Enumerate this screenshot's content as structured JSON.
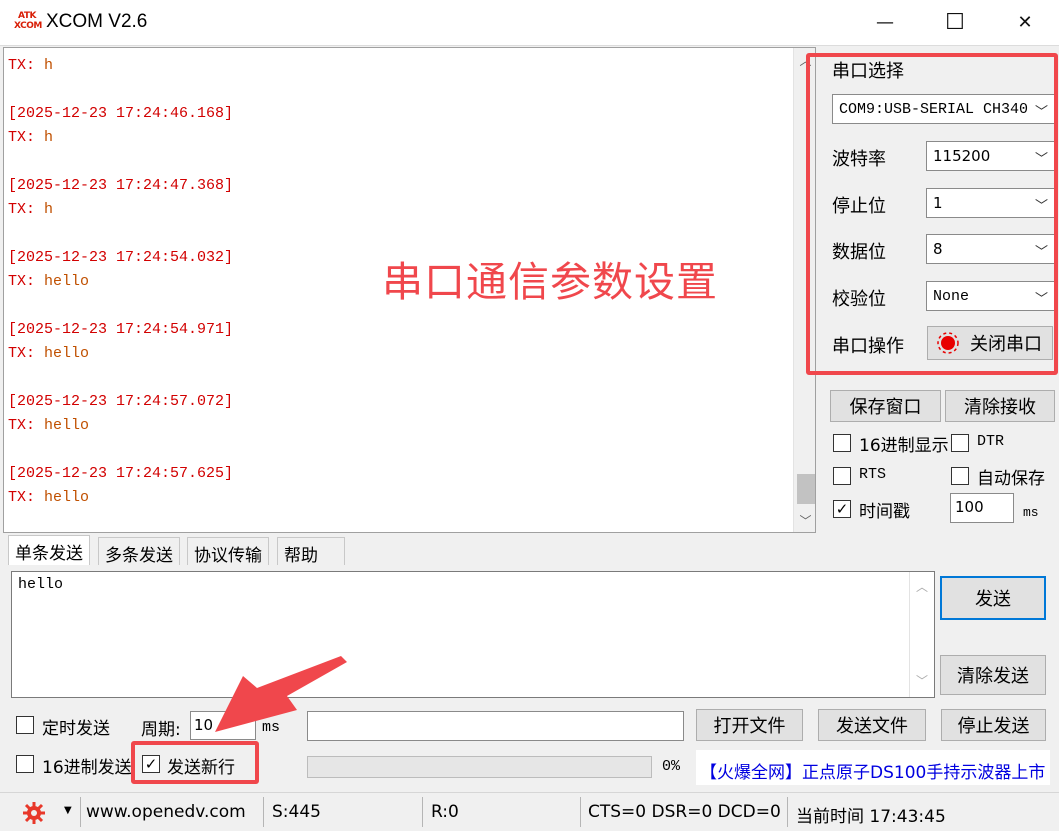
{
  "window": {
    "title": "XCOM V2.6",
    "icon_text_top": "ATK",
    "icon_text_bottom": "XCOM",
    "minimize": "—",
    "maximize": "☐",
    "close": "✕"
  },
  "receive": {
    "lines": [
      {
        "kind": "tx",
        "label": "TX:",
        "data": "h"
      },
      {
        "kind": "blank"
      },
      {
        "kind": "ts",
        "text": "[2025-12-23 17:24:46.168]"
      },
      {
        "kind": "tx",
        "label": "TX:",
        "data": "h"
      },
      {
        "kind": "blank"
      },
      {
        "kind": "ts",
        "text": "[2025-12-23 17:24:47.368]"
      },
      {
        "kind": "tx",
        "label": "TX:",
        "data": "h"
      },
      {
        "kind": "blank"
      },
      {
        "kind": "ts",
        "text": "[2025-12-23 17:24:54.032]"
      },
      {
        "kind": "tx",
        "label": "TX:",
        "data": "hello"
      },
      {
        "kind": "blank"
      },
      {
        "kind": "ts",
        "text": "[2025-12-23 17:24:54.971]"
      },
      {
        "kind": "tx",
        "label": "TX:",
        "data": "hello"
      },
      {
        "kind": "blank"
      },
      {
        "kind": "ts",
        "text": "[2025-12-23 17:24:57.072]"
      },
      {
        "kind": "tx",
        "label": "TX:",
        "data": "hello"
      },
      {
        "kind": "blank"
      },
      {
        "kind": "ts",
        "text": "[2025-12-23 17:24:57.625]"
      },
      {
        "kind": "tx",
        "label": "TX:",
        "data": "hello"
      }
    ],
    "annotation": "串口通信参数设置"
  },
  "serial": {
    "section_label": "串口选择",
    "port_value": "COM9:USB-SERIAL CH340",
    "baud_label": "波特率",
    "baud_value": "115200",
    "stop_label": "停止位",
    "stop_value": "1",
    "data_label": "数据位",
    "data_value": "8",
    "parity_label": "校验位",
    "parity_value": "None",
    "op_label": "串口操作",
    "op_button": "关闭串口",
    "accent": "#f0474c"
  },
  "options": {
    "save_window": "保存窗口",
    "clear_recv": "清除接收",
    "hex_display": "16进制显示",
    "dtr": "DTR",
    "rts": "RTS",
    "auto_save": "自动保存",
    "timestamp": "时间戳",
    "timestamp_checked": true,
    "timestamp_value": "100",
    "timestamp_unit": "ms"
  },
  "tabs": [
    "单条发送",
    "多条发送",
    "协议传输",
    "帮助"
  ],
  "send": {
    "text": "hello",
    "send_button": "发送",
    "clear_send": "清除发送",
    "timed_send": "定时发送",
    "period_label": "周期:",
    "period_value": "10",
    "period_unit": "ms",
    "open_file": "打开文件",
    "send_file": "发送文件",
    "stop_send": "停止发送",
    "hex_send": "16进制发送",
    "send_newline": "发送新行",
    "send_newline_checked": true,
    "progress": "0%",
    "promo": "【火爆全网】正点原子DS100手持示波器上市"
  },
  "status": {
    "site": "www.openedv.com",
    "sent": "S:445",
    "received": "R:0",
    "lines": "CTS=0 DSR=0 DCD=0",
    "time": "当前时间 17:43:45"
  }
}
